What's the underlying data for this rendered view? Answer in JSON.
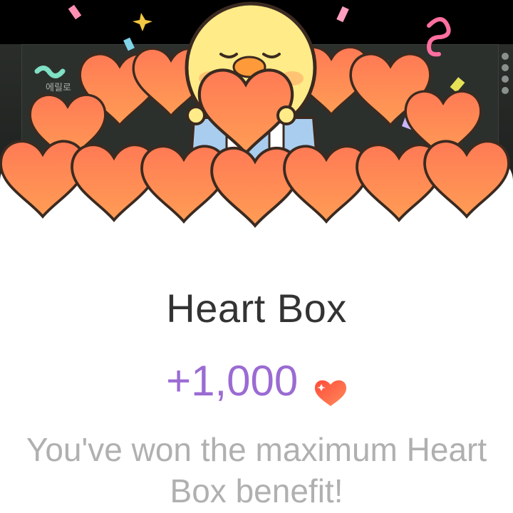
{
  "background": {
    "overlay_text": "에릴로"
  },
  "popup": {
    "title": "Heart Box",
    "reward_amount": "+1,000",
    "reward_icon": "heart-icon",
    "message": "You've won the maximum Heart Box benefit!"
  },
  "colors": {
    "title": "#333333",
    "reward": "#9b6bd3",
    "message": "#b0b0b0",
    "heart": "#ff5b43"
  }
}
